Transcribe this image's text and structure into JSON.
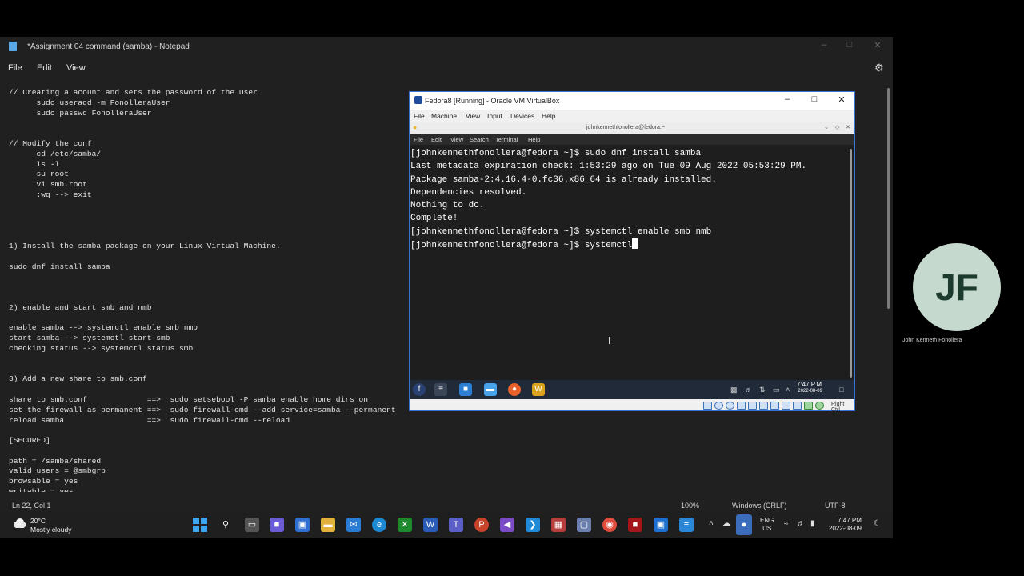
{
  "notepad": {
    "title": "*Assignment 04 command (samba) - Notepad",
    "menu": [
      "File",
      "Edit",
      "View"
    ],
    "content": "// Creating a acount and sets the password of the User\n      sudo useradd -m FonolleraUser\n      sudo passwd FonolleraUser\n\n\n// Modify the conf\n      cd /etc/samba/\n      ls -l\n      su root\n      vi smb.root\n      :wq --> exit\n\n\n\n\n1) Install the samba package on your Linux Virtual Machine.\n\nsudo dnf install samba\n\n\n\n2) enable and start smb and nmb\n\nenable samba --> systemctl enable smb nmb\nstart samba --> systemctl start smb\nchecking status --> systemctl status smb\n\n\n3) Add a new share to smb.conf\n\nshare to smb.conf             ==>  sudo setsebool -P samba enable home dirs on\nset the firewall as permanent ==>  sudo firewall-cmd --add-service=samba --permanent\nreload samba                  ==>  sudo firewall-cmd --reload\n\n[SECURED]\n\npath = /samba/shared\nvalid users = @smbgrp\nbrowsable = yes\nwritable = yes\nread only = no",
    "status": {
      "position": "Ln 22, Col 1",
      "zoom": "100%",
      "line_ending": "Windows (CRLF)",
      "encoding": "UTF-8"
    }
  },
  "virtualbox": {
    "title": "Fedora8 [Running] - Oracle VM VirtualBox",
    "menu": [
      "File",
      "Machine",
      "View",
      "Input",
      "Devices",
      "Help"
    ],
    "host_key": "Right Ctrl",
    "guest": {
      "terminal_title": "johnkennethfonollera@fedora:~",
      "terminal_menu": [
        "File",
        "Edit",
        "View",
        "Search",
        "Terminal",
        "Help"
      ],
      "terminal_output": "[johnkennethfonollera@fedora ~]$ sudo dnf install samba\nLast metadata expiration check: 1:53:29 ago on Tue 09 Aug 2022 05:53:29 PM.\nPackage samba-2:4.16.4-0.fc36.x86_64 is already installed.\nDependencies resolved.\nNothing to do.\nComplete!\n[johnkennethfonollera@fedora ~]$ systemctl enable smb nmb",
      "terminal_current_line": "[johnkennethfonollera@fedora ~]$ systemctl",
      "clock_time": "7:47 P.M.",
      "clock_date": "2022-08-09"
    }
  },
  "participant": {
    "initials": "JF",
    "name": "John Kenneth Fonollera"
  },
  "taskbar": {
    "weather_temp": "20°C",
    "weather_desc": "Mostly cloudy",
    "lang_primary": "ENG",
    "lang_secondary": "US",
    "time": "7:47 PM",
    "date": "2022-08-09"
  }
}
